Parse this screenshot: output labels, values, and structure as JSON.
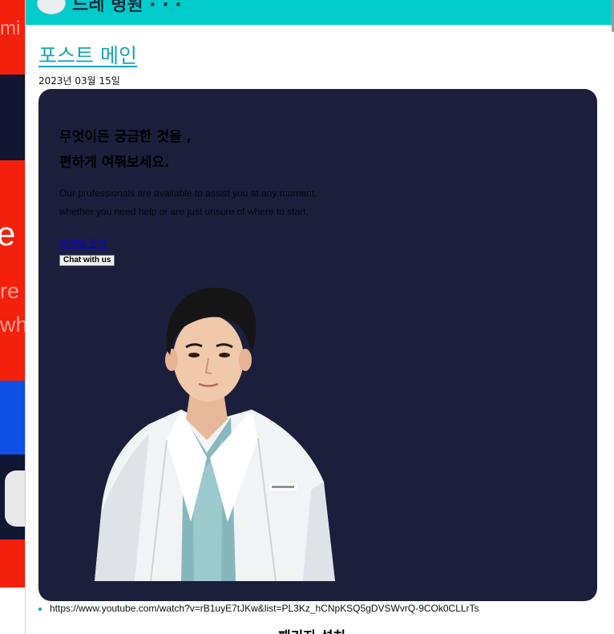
{
  "background": {
    "text_top": "mi",
    "text_mid": "e c",
    "text_line1": "re",
    "text_line2": "whe"
  },
  "header": {
    "title": "드레 병원 · · ·"
  },
  "post": {
    "title": "포스트 메인",
    "date": "2023년 03월 15일"
  },
  "card": {
    "heading_line1": "무엇이든 궁금한 것을 ,",
    "heading_line2": "편하게 여쭤보세요.",
    "body_line1": "Our professionals are available to assist you at any moment,",
    "body_line2": "whether you need help or are just unsure of where to start.",
    "email_link": "이메일 문의",
    "chat_button": "Chat with us"
  },
  "video": {
    "url": "https://www.youtube.com/watch?v=rB1uyE7tJKw&list=PL3Kz_hCNpKSQ5gDVSWvrQ-9COk0CLLrTs"
  },
  "next_section": {
    "title": "패키지 설치"
  },
  "colors": {
    "header_teal": "#00cccc",
    "card_navy": "#1b1f3c",
    "link_teal": "#17a3b5",
    "bg_red": "#f3200b",
    "bg_blue": "#0e4fe6"
  }
}
